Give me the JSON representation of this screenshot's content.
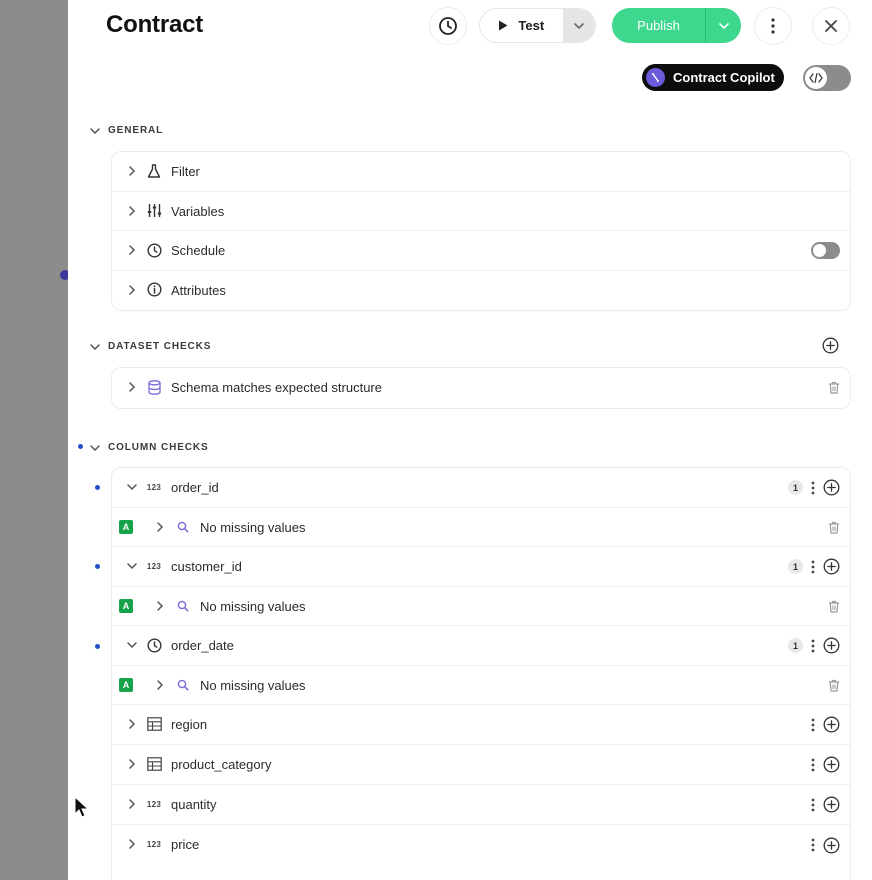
{
  "header": {
    "title": "Contract",
    "test_label": "Test",
    "publish_label": "Publish"
  },
  "copilot": {
    "label": "Contract Copilot"
  },
  "sections": {
    "general": {
      "title": "GENERAL",
      "items": [
        {
          "label": "Filter",
          "icon": "flask-icon"
        },
        {
          "label": "Variables",
          "icon": "sliders-icon"
        },
        {
          "label": "Schedule",
          "icon": "clock-icon",
          "toggle_on": false
        },
        {
          "label": "Attributes",
          "icon": "info-icon"
        }
      ]
    },
    "dataset_checks": {
      "title": "DATASET CHECKS",
      "items": [
        {
          "label": "Schema matches expected structure",
          "icon": "database-icon"
        }
      ]
    },
    "column_checks": {
      "title": "COLUMN CHECKS",
      "columns": [
        {
          "name": "order_id",
          "type_icon": "123",
          "count": "1",
          "check": "No missing values",
          "badge": "A"
        },
        {
          "name": "customer_id",
          "type_icon": "123",
          "count": "1",
          "check": "No missing values",
          "badge": "A"
        },
        {
          "name": "order_date",
          "type_icon": "clock-icon",
          "count": "1",
          "check": "No missing values",
          "badge": "A"
        },
        {
          "name": "region",
          "type_icon": "table-icon"
        },
        {
          "name": "product_category",
          "type_icon": "table-icon"
        },
        {
          "name": "quantity",
          "type_icon": "123"
        },
        {
          "name": "price",
          "type_icon": "123"
        }
      ]
    }
  },
  "colors": {
    "publish": "#3ed78e",
    "accent_dot": "#2450c9",
    "badge_green": "#17a34a",
    "copilot_bg": "#0d0d0d"
  }
}
